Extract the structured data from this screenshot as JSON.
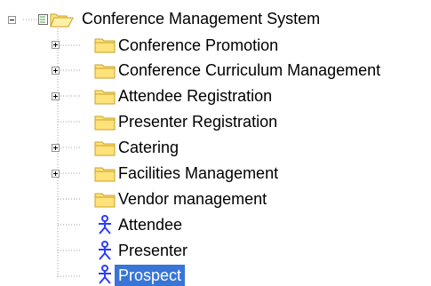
{
  "tree": {
    "root": {
      "label": "Conference Management System",
      "expanded": true,
      "icon": "open-folder-icon"
    },
    "children": [
      {
        "label": "Conference Promotion",
        "type": "folder",
        "has_children": true
      },
      {
        "label": "Conference Curriculum Management",
        "type": "folder",
        "has_children": true
      },
      {
        "label": "Attendee Registration",
        "type": "folder",
        "has_children": true
      },
      {
        "label": "Presenter Registration",
        "type": "folder",
        "has_children": false
      },
      {
        "label": "Catering",
        "type": "folder",
        "has_children": true
      },
      {
        "label": "Facilities Management",
        "type": "folder",
        "has_children": true
      },
      {
        "label": "Vendor management",
        "type": "folder",
        "has_children": false
      },
      {
        "label": "Attendee",
        "type": "actor",
        "has_children": false
      },
      {
        "label": "Presenter",
        "type": "actor",
        "has_children": false
      },
      {
        "label": "Prospect",
        "type": "actor",
        "has_children": false,
        "selected": true
      }
    ]
  },
  "colors": {
    "folder_fill": "#ffe27a",
    "folder_stroke": "#c9a227",
    "actor": "#2d3cff",
    "selection": "#3875d7",
    "tree_lines": "#a0a0a0"
  }
}
